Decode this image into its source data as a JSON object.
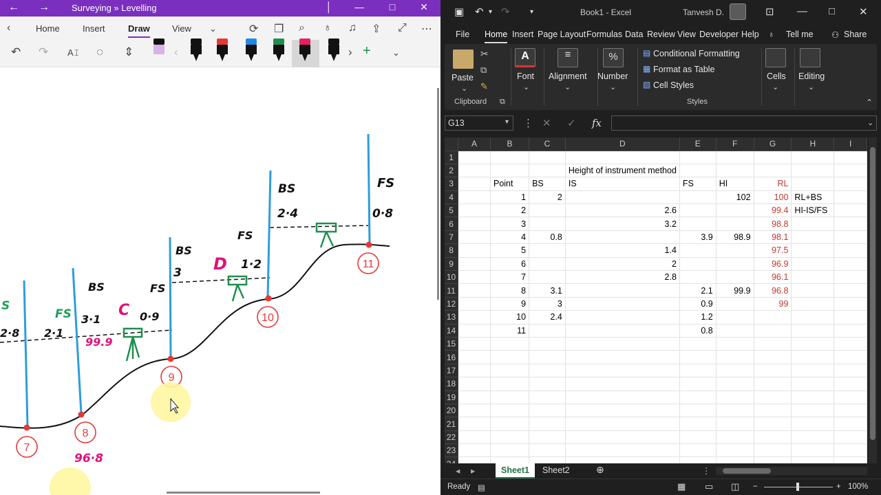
{
  "onenote": {
    "title": "Surveying » Levelling",
    "tabs": [
      "Home",
      "Insert",
      "Draw",
      "View"
    ],
    "active_tab": "Draw",
    "accent": "#7b2fbe",
    "pen_colors": [
      "#f0c419",
      "#111111",
      "#e53935",
      "#1e88e5",
      "#1e8f4e",
      "#e91e63",
      "#111111"
    ]
  },
  "sketch": {
    "labels": [
      {
        "text": "2·8",
        "color": "#111"
      },
      {
        "text": "2·1",
        "color": "#111"
      },
      {
        "text": "BS",
        "color": "#111"
      },
      {
        "text": "FS",
        "color": "#1e9e5a"
      },
      {
        "text": "3·1",
        "color": "#111"
      },
      {
        "text": "C",
        "color": "#e0107a"
      },
      {
        "text": "0·9",
        "color": "#111"
      },
      {
        "text": "99.9",
        "color": "#e0107a"
      },
      {
        "text": "BS",
        "color": "#111"
      },
      {
        "text": "3",
        "color": "#111"
      },
      {
        "text": "FS",
        "color": "#111"
      },
      {
        "text": "D",
        "color": "#e0107a"
      },
      {
        "text": "1·2",
        "color": "#111"
      },
      {
        "text": "FS",
        "color": "#111"
      },
      {
        "text": "BS",
        "color": "#111"
      },
      {
        "text": "2·4",
        "color": "#111"
      },
      {
        "text": "FS",
        "color": "#111"
      },
      {
        "text": "0·8",
        "color": "#111"
      },
      {
        "text": "96·8",
        "color": "#e0107a"
      },
      {
        "text": "S",
        "color": "#1e9e5a"
      }
    ],
    "points": [
      "7",
      "8",
      "9",
      "10",
      "11"
    ]
  },
  "excel": {
    "title": "Book1 - Excel",
    "user": "Tanvesh D.",
    "tabs": [
      "File",
      "Home",
      "Insert",
      "Page Layout",
      "Formulas",
      "Data",
      "Review",
      "View",
      "Developer",
      "Help"
    ],
    "tell_me": "Tell me",
    "share": "Share",
    "ribbon": {
      "paste": "Paste",
      "clipboard": "Clipboard",
      "font": "Font",
      "alignment": "Alignment",
      "number": "Number",
      "conditional": "Conditional Formatting",
      "format_table": "Format as Table",
      "cell_styles": "Cell Styles",
      "styles": "Styles",
      "cells": "Cells",
      "editing": "Editing"
    },
    "name_box": "G13",
    "columns": [
      "A",
      "B",
      "C",
      "D",
      "E",
      "F",
      "G",
      "H",
      "I"
    ],
    "rows": [
      {
        "n": "1",
        "cells": [
          "",
          "",
          "",
          "",
          "",
          "",
          "",
          "",
          ""
        ]
      },
      {
        "n": "2",
        "cells": [
          "",
          "",
          "",
          "Height of instrument method",
          "",
          "",
          "",
          "",
          ""
        ]
      },
      {
        "n": "3",
        "cells": [
          "",
          "Point",
          "BS",
          "IS",
          "FS",
          "HI",
          "RL",
          "",
          ""
        ]
      },
      {
        "n": "4",
        "cells": [
          "",
          "1",
          "2",
          "",
          "",
          "102",
          "100",
          "RL+BS",
          ""
        ]
      },
      {
        "n": "5",
        "cells": [
          "",
          "2",
          "",
          "2.6",
          "",
          "",
          "99.4",
          "HI-IS/FS",
          ""
        ]
      },
      {
        "n": "6",
        "cells": [
          "",
          "3",
          "",
          "3.2",
          "",
          "",
          "98.8",
          "",
          ""
        ]
      },
      {
        "n": "7",
        "cells": [
          "",
          "4",
          "0.8",
          "",
          "3.9",
          "98.9",
          "98.1",
          "",
          ""
        ]
      },
      {
        "n": "8",
        "cells": [
          "",
          "5",
          "",
          "1.4",
          "",
          "",
          "97.5",
          "",
          ""
        ]
      },
      {
        "n": "9",
        "cells": [
          "",
          "6",
          "",
          "2",
          "",
          "",
          "96.9",
          "",
          ""
        ]
      },
      {
        "n": "10",
        "cells": [
          "",
          "7",
          "",
          "2.8",
          "",
          "",
          "96.1",
          "",
          ""
        ]
      },
      {
        "n": "11",
        "cells": [
          "",
          "8",
          "3.1",
          "",
          "2.1",
          "99.9",
          "96.8",
          "",
          ""
        ]
      },
      {
        "n": "12",
        "cells": [
          "",
          "9",
          "3",
          "",
          "0.9",
          "",
          "99",
          "",
          ""
        ]
      },
      {
        "n": "13",
        "cells": [
          "",
          "10",
          "2.4",
          "",
          "1.2",
          "",
          "",
          "",
          ""
        ]
      },
      {
        "n": "14",
        "cells": [
          "",
          "11",
          "",
          "",
          "0.8",
          "",
          "",
          "",
          ""
        ]
      },
      {
        "n": "15",
        "cells": [
          "",
          "",
          "",
          "",
          "",
          "",
          "",
          "",
          ""
        ]
      },
      {
        "n": "16",
        "cells": [
          "",
          "",
          "",
          "",
          "",
          "",
          "",
          "",
          ""
        ]
      },
      {
        "n": "17",
        "cells": [
          "",
          "",
          "",
          "",
          "",
          "",
          "",
          "",
          ""
        ]
      },
      {
        "n": "18",
        "cells": [
          "",
          "",
          "",
          "",
          "",
          "",
          "",
          "",
          ""
        ]
      },
      {
        "n": "19",
        "cells": [
          "",
          "",
          "",
          "",
          "",
          "",
          "",
          "",
          ""
        ]
      },
      {
        "n": "20",
        "cells": [
          "",
          "",
          "",
          "",
          "",
          "",
          "",
          "",
          ""
        ]
      },
      {
        "n": "21",
        "cells": [
          "",
          "",
          "",
          "",
          "",
          "",
          "",
          "",
          ""
        ]
      },
      {
        "n": "22",
        "cells": [
          "",
          "",
          "",
          "",
          "",
          "",
          "",
          "",
          ""
        ]
      },
      {
        "n": "23",
        "cells": [
          "",
          "",
          "",
          "",
          "",
          "",
          "",
          "",
          ""
        ]
      },
      {
        "n": "24",
        "cells": [
          "",
          "",
          "",
          "",
          "",
          "",
          "",
          "",
          ""
        ]
      }
    ],
    "red_col": 6,
    "sheets": [
      "Sheet1",
      "Sheet2"
    ],
    "active_sheet": "Sheet1",
    "status": "Ready",
    "zoom": "100%"
  }
}
